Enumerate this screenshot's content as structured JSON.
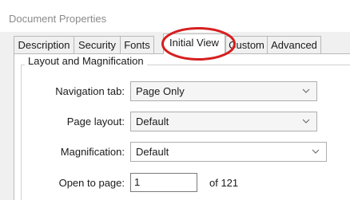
{
  "window": {
    "title": "Document Properties"
  },
  "tabs": [
    {
      "label": "Description",
      "active": false
    },
    {
      "label": "Security",
      "active": false
    },
    {
      "label": "Fonts",
      "active": false
    },
    {
      "label": "Initial View",
      "active": true
    },
    {
      "label": "Custom",
      "active": false
    },
    {
      "label": "Advanced",
      "active": false
    }
  ],
  "group": {
    "legend": "Layout and Magnification"
  },
  "fields": {
    "navigation_tab": {
      "label": "Navigation tab:",
      "value": "Page Only"
    },
    "page_layout": {
      "label": "Page layout:",
      "value": "Default"
    },
    "magnification": {
      "label": "Magnification:",
      "value": "Default"
    },
    "open_to_page": {
      "label": "Open to page:",
      "value": "1",
      "suffix": "of 121"
    }
  },
  "annotation": {
    "highlight_color": "#d61f1f",
    "highlights": "Initial View"
  },
  "icons": {
    "dropdown": "chevron-down-icon"
  }
}
